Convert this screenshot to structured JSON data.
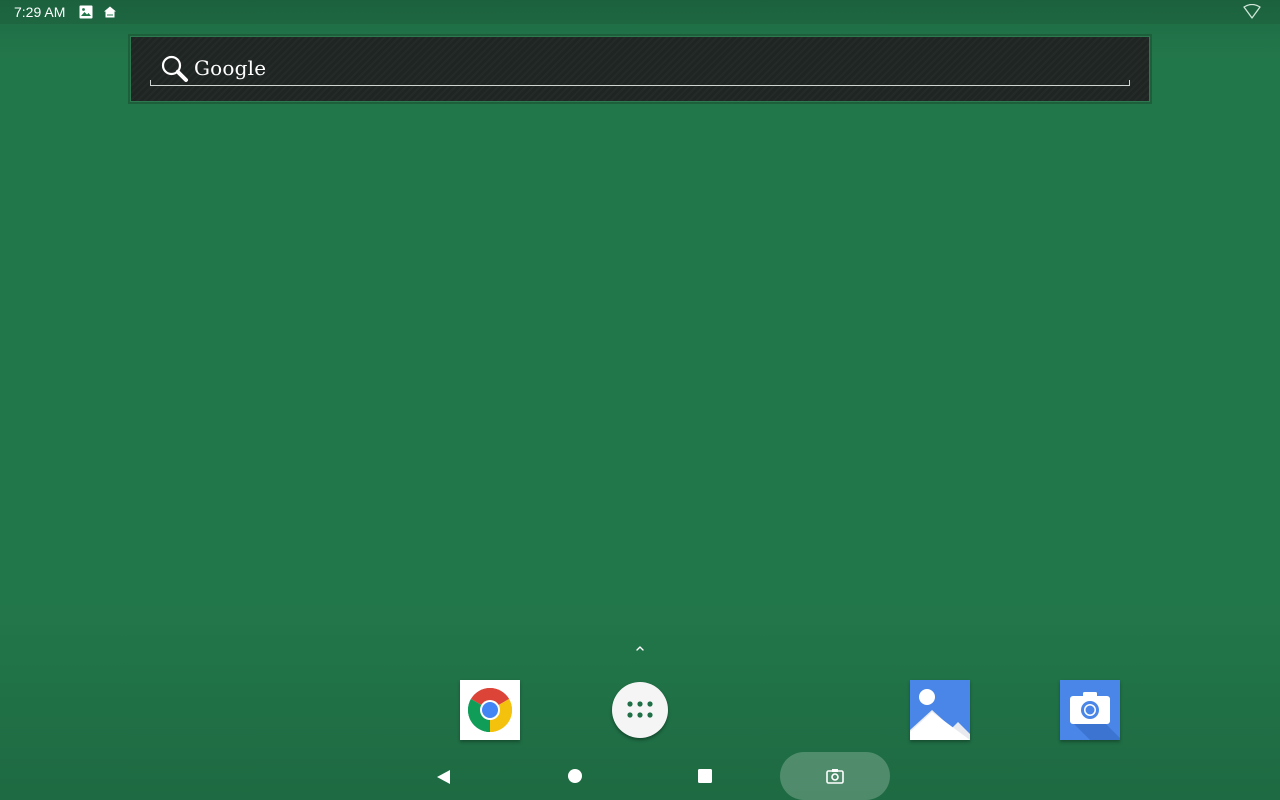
{
  "status_bar": {
    "time": "7:29 AM",
    "icons": [
      "image-notification-icon",
      "home-notification-icon",
      "wifi-icon"
    ]
  },
  "search_widget": {
    "label": "Google",
    "icon": "search-icon"
  },
  "launcher": {
    "drawer_arrow_icon": "chevron-up-icon"
  },
  "dock": {
    "apps": [
      {
        "name": "chrome",
        "icon": "chrome-icon"
      },
      {
        "name": "all-apps",
        "icon": "app-drawer-icon"
      },
      {
        "name": "gallery",
        "icon": "gallery-icon"
      },
      {
        "name": "camera",
        "icon": "camera-icon"
      }
    ]
  },
  "nav_bar": {
    "buttons": [
      "back-icon",
      "home-icon",
      "recents-icon",
      "screenshot-icon"
    ]
  },
  "colors": {
    "wallpaper": "#22774a",
    "widget_bg": "#1f2522",
    "app_blue": "#4a86e8"
  }
}
